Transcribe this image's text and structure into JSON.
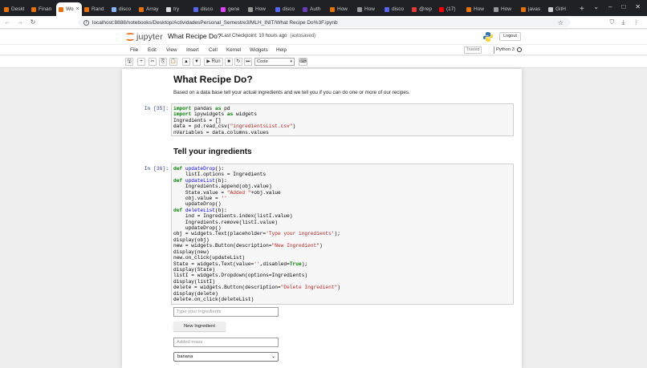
{
  "browser": {
    "tabs": [
      {
        "label": "Deskt",
        "color": "#e8710a"
      },
      {
        "label": "Finan",
        "color": "#e8710a"
      },
      {
        "label": "Wo",
        "color": "#e8710a",
        "active": true
      },
      {
        "label": "Rand",
        "color": "#e8710a"
      },
      {
        "label": "disco",
        "color": "#8ab4f8"
      },
      {
        "label": "Array",
        "color": "#e8710a"
      },
      {
        "label": "try",
        "color": "#dddddd"
      },
      {
        "label": "disco",
        "color": "#5865f2"
      },
      {
        "label": "gene",
        "color": "#e040fb"
      },
      {
        "label": "How",
        "color": "#999999"
      },
      {
        "label": "disco",
        "color": "#5865f2"
      },
      {
        "label": "Auth",
        "color": "#673ab7"
      },
      {
        "label": "How",
        "color": "#e8710a"
      },
      {
        "label": "How",
        "color": "#999999"
      },
      {
        "label": "disco",
        "color": "#5865f2"
      },
      {
        "label": "@rep",
        "color": "#e53935"
      },
      {
        "label": "(17)",
        "color": "#ff0000"
      },
      {
        "label": "How",
        "color": "#e8710a"
      },
      {
        "label": "How",
        "color": "#999999"
      },
      {
        "label": "javas",
        "color": "#e8710a"
      },
      {
        "label": "GitH",
        "color": "#cccccc"
      }
    ],
    "active_tab_close": "×",
    "new_tab": "+",
    "window_controls": [
      "⌄",
      "–",
      "□",
      "✕"
    ],
    "url": "localhost:8888/notebooks/Desktop/ActividadesPersonal_Semestre3/MLH_INIT/What Recipe Do%3F.ipynb",
    "nav": {
      "back": "←",
      "forward": "→",
      "reload": "↻"
    },
    "right_icons": [
      "⛉",
      "⤓",
      "⋮"
    ]
  },
  "jupyter": {
    "logo_text": "jupyter",
    "notebook_name": "What Recipe Do?",
    "checkpoint": "Last Checkpoint: 10 hours ago",
    "autosave": "(autosaved)",
    "logout": "Logout",
    "menu": [
      "File",
      "Edit",
      "View",
      "Insert",
      "Cell",
      "Kernel",
      "Widgets",
      "Help"
    ],
    "trusted": "Trusted",
    "kernel": "Python 3",
    "toolbar": {
      "save": "🖫",
      "add": "+",
      "cut": "✂",
      "copy": "⎘",
      "paste": "📋",
      "up": "▲",
      "down": "▼",
      "run": "▶ Run",
      "stop": "■",
      "restart": "↻",
      "fastforward": "⏭",
      "cell_type": "Code",
      "keyboard": "⌨"
    }
  },
  "notebook": {
    "heading1": "What Recipe Do?",
    "intro": "Based on a data base tell your actual ingredients and we tell you if you can do one or more of our recipes.",
    "heading2": "Tell your ingredients",
    "cell1_prompt": "In [35]:",
    "cell2_prompt": "In [36]:",
    "widgets": {
      "ingredient_placeholder": "Type your ingredients",
      "new_button": "New Ingredient",
      "state_placeholder": "Added mass",
      "dropdown_value": "banana"
    }
  }
}
